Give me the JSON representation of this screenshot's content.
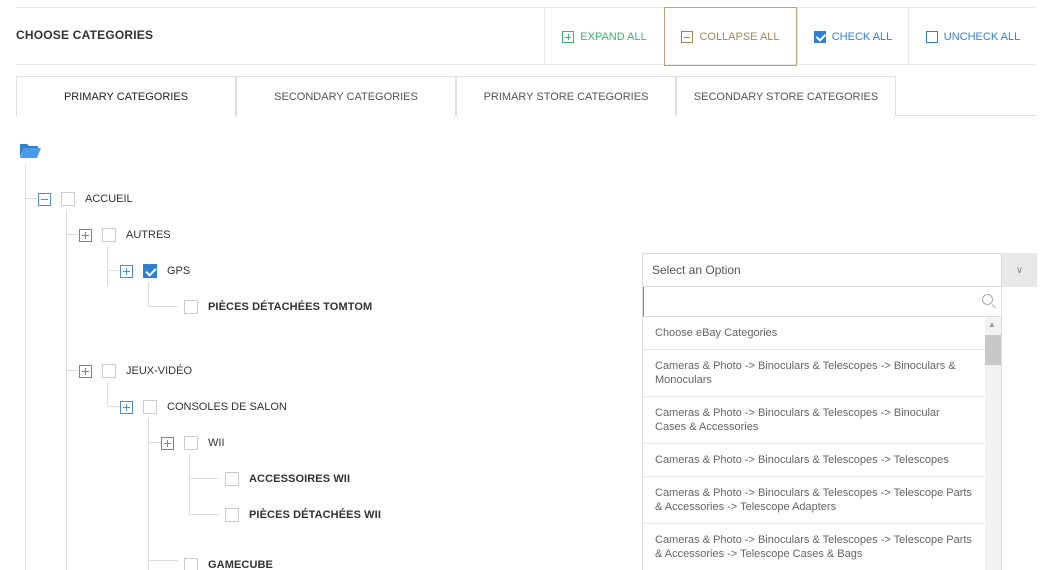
{
  "header": {
    "title": "CHOOSE CATEGORIES",
    "expand_all": "EXPAND ALL",
    "collapse_all": "COLLAPSE ALL",
    "check_all": "CHECK ALL",
    "uncheck_all": "UNCHECK ALL"
  },
  "tabs": [
    {
      "label": "PRIMARY CATEGORIES",
      "active": true
    },
    {
      "label": "SECONDARY CATEGORIES",
      "active": false
    },
    {
      "label": "PRIMARY STORE CATEGORIES",
      "active": false
    },
    {
      "label": "SECONDARY STORE CATEGORIES",
      "active": false
    }
  ],
  "tree": {
    "root_icon": "folder-open-icon",
    "nodes": [
      {
        "label": "ACCUEIL",
        "toggle": "minus",
        "checked": false
      },
      {
        "label": "AUTRES",
        "toggle": "plus",
        "checked": false
      },
      {
        "label": "GPS",
        "toggle": "plus",
        "checked": true
      },
      {
        "label": "PIÈCES DÉTACHÉES TOMTOM",
        "toggle": null,
        "checked": false
      },
      {
        "label": "JEUX-VIDÉO",
        "toggle": "plus",
        "checked": false
      },
      {
        "label": "CONSOLES DE SALON",
        "toggle": "plus",
        "checked": false
      },
      {
        "label": "WII",
        "toggle": "plus",
        "checked": false
      },
      {
        "label": "ACCESSOIRES WII",
        "toggle": null,
        "checked": false
      },
      {
        "label": "PIÈCES DÉTACHÉES WII",
        "toggle": null,
        "checked": false
      },
      {
        "label": "GAMECUBE",
        "toggle": null,
        "checked": false
      }
    ]
  },
  "select": {
    "placeholder": "Select an Option",
    "search_value": "",
    "options": [
      "Choose eBay Categories",
      "Cameras & Photo -> Binoculars & Telescopes -> Binoculars & Monoculars",
      "Cameras & Photo -> Binoculars & Telescopes -> Binocular Cases & Accessories",
      "Cameras & Photo -> Binoculars & Telescopes -> Telescopes",
      "Cameras & Photo -> Binoculars & Telescopes -> Telescope Parts & Accessories -> Telescope Adapters",
      "Cameras & Photo -> Binoculars & Telescopes -> Telescope Parts & Accessories -> Telescope Cases & Bags"
    ]
  },
  "colors": {
    "accent_blue": "#2f80d1",
    "expand_green": "#3cb371",
    "collapse_olive": "#9a8a5a"
  }
}
